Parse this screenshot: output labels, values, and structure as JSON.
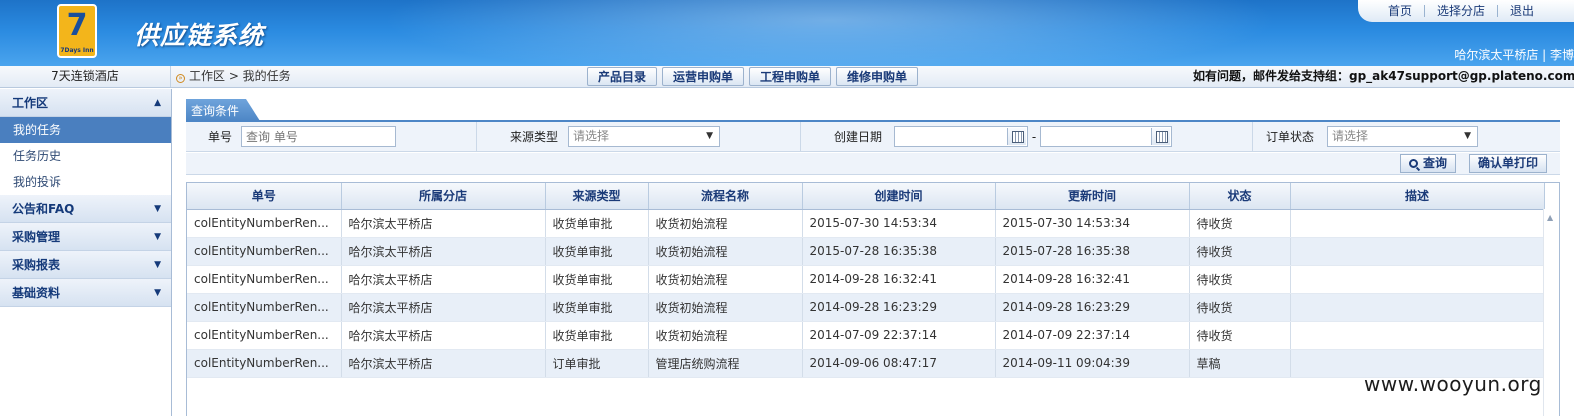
{
  "header": {
    "logo_number": "7",
    "logo_text": "7Days Inn",
    "app_title": "供应链系统",
    "topnav": [
      "首页",
      "选择分店",
      "退出"
    ],
    "user_line": "哈尔滨太平桥店 | 李博"
  },
  "crumbbar": {
    "hotel_name": "7天连锁酒店",
    "crumb_icon": "»",
    "breadcrumb": "工作区 > 我的任务",
    "quick_buttons": [
      "产品目录",
      "运营申购单",
      "工程申购单",
      "维修申购单"
    ],
    "support_text": "如有问题，邮件发给支持组：gp_ak47support@gp.plateno.com"
  },
  "sidebar": {
    "workspace": {
      "label": "工作区",
      "arrow": "▲",
      "items": [
        "我的任务",
        "任务历史",
        "我的投诉"
      ]
    },
    "collapsed": [
      {
        "label": "公告和FAQ",
        "arrow": "▼"
      },
      {
        "label": "采购管理",
        "arrow": "▼"
      },
      {
        "label": "采购报表",
        "arrow": "▼"
      },
      {
        "label": "基础资料",
        "arrow": "▼"
      }
    ]
  },
  "query": {
    "tab_label": "查询条件",
    "order_no_label": "单号",
    "order_no_placeholder": "查询 单号",
    "source_type_label": "来源类型",
    "source_type_value": "请选择",
    "created_date_label": "创建日期",
    "date_sep": "-",
    "order_status_label": "订单状态",
    "order_status_value": "请选择",
    "dropdown_arrow": "▼",
    "search_button": "查询",
    "print_button": "确认单打印"
  },
  "grid": {
    "columns": [
      "单号",
      "所属分店",
      "来源类型",
      "流程名称",
      "创建时间",
      "更新时间",
      "状态",
      "描述"
    ],
    "rows": [
      [
        "colEntityNumberRen...",
        "哈尔滨太平桥店",
        "收货单审批",
        "收货初始流程",
        "2015-07-30 14:53:34",
        "2015-07-30 14:53:34",
        "待收货",
        ""
      ],
      [
        "colEntityNumberRen...",
        "哈尔滨太平桥店",
        "收货单审批",
        "收货初始流程",
        "2015-07-28 16:35:38",
        "2015-07-28 16:35:38",
        "待收货",
        ""
      ],
      [
        "colEntityNumberRen...",
        "哈尔滨太平桥店",
        "收货单审批",
        "收货初始流程",
        "2014-09-28 16:32:41",
        "2014-09-28 16:32:41",
        "待收货",
        ""
      ],
      [
        "colEntityNumberRen...",
        "哈尔滨太平桥店",
        "收货单审批",
        "收货初始流程",
        "2014-09-28 16:23:29",
        "2014-09-28 16:23:29",
        "待收货",
        ""
      ],
      [
        "colEntityNumberRen...",
        "哈尔滨太平桥店",
        "收货单审批",
        "收货初始流程",
        "2014-07-09 22:37:14",
        "2014-07-09 22:37:14",
        "待收货",
        ""
      ],
      [
        "colEntityNumberRen...",
        "哈尔滨太平桥店",
        "订单审批",
        "管理店统购流程",
        "2014-09-06 08:47:17",
        "2014-09-11 09:04:39",
        "草稿",
        ""
      ]
    ],
    "scroll_up_glyph": "▲"
  },
  "watermark": "www.wooyun.org",
  "colors": {
    "header_blue": "#2a8ae0",
    "sidebar_active": "#4a7fbf",
    "title_text": "#1a3a78",
    "alt_row": "#e8eff8"
  }
}
